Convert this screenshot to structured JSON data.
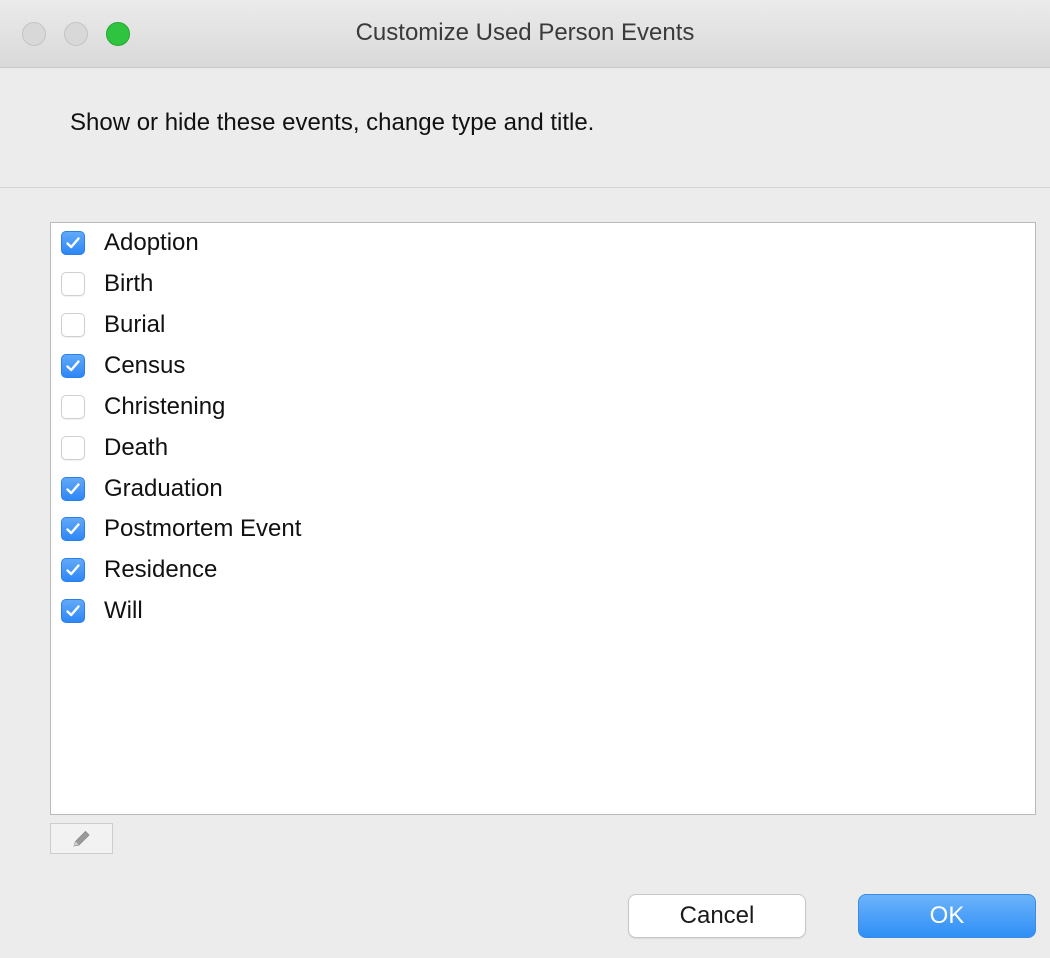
{
  "window": {
    "title": "Customize Used Person Events"
  },
  "header": {
    "instructions": "Show or hide these events, change type and title."
  },
  "events": {
    "items": [
      {
        "label": "Adoption",
        "checked": true
      },
      {
        "label": "Birth",
        "checked": false
      },
      {
        "label": "Burial",
        "checked": false
      },
      {
        "label": "Census",
        "checked": true
      },
      {
        "label": "Christening",
        "checked": false
      },
      {
        "label": "Death",
        "checked": false
      },
      {
        "label": "Graduation",
        "checked": true
      },
      {
        "label": "Postmortem Event",
        "checked": true
      },
      {
        "label": "Residence",
        "checked": true
      },
      {
        "label": "Will",
        "checked": true
      }
    ]
  },
  "toolbar": {
    "edit_icon": "pencil-icon"
  },
  "buttons": {
    "cancel_label": "Cancel",
    "ok_label": "OK"
  },
  "colors": {
    "accent": "#2d87f5",
    "zoom_button": "#2fc43f"
  }
}
